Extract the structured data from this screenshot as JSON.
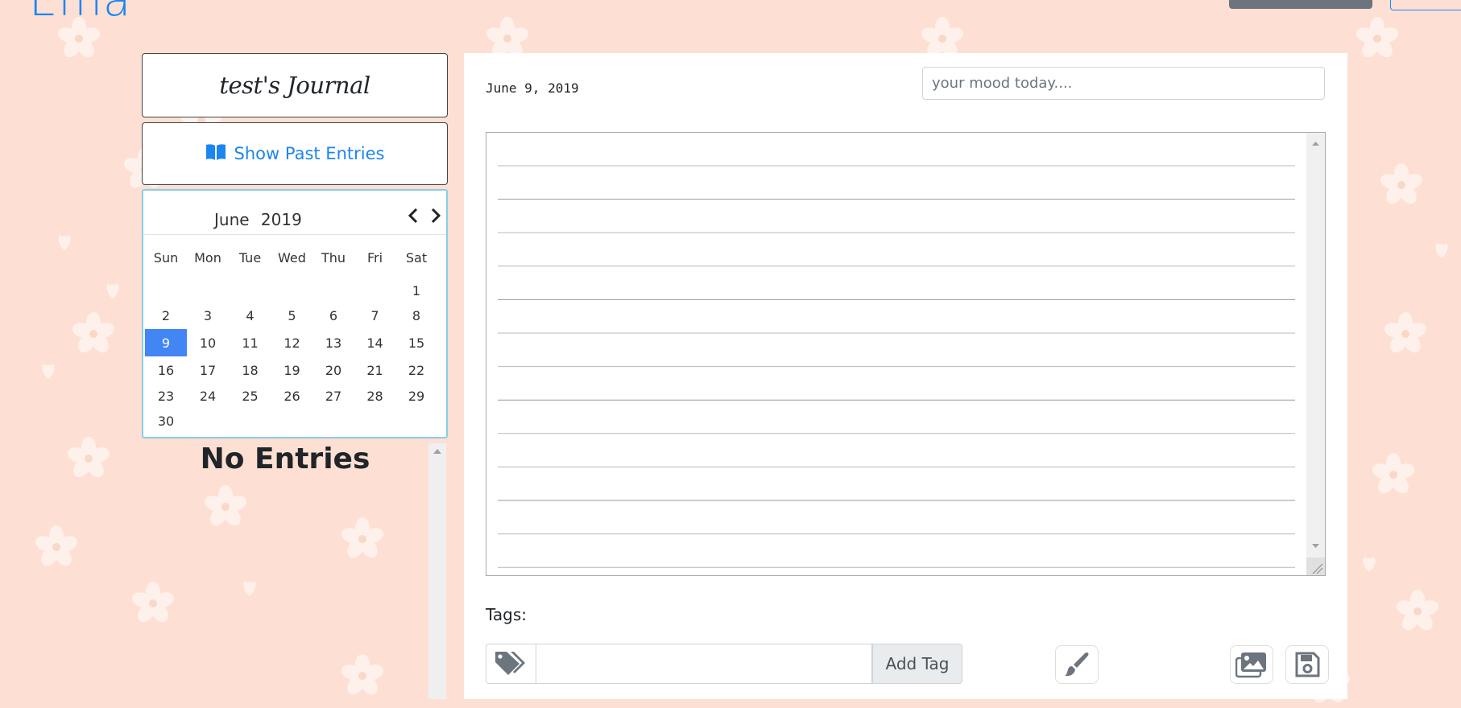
{
  "app": {
    "brand": "Ema",
    "colors": {
      "accent": "#1a86f2",
      "background": "#fde0d3",
      "selected_day": "#4285f4",
      "calendar_border": "#87ceeb"
    }
  },
  "sidebar": {
    "journal_title": "test's Journal",
    "past_entries_label": "Show Past Entries",
    "past_entries_icon": "book-open-icon",
    "no_entries_text": "No Entries"
  },
  "calendar": {
    "month": "June",
    "year": "2019",
    "weekdays": [
      "Sun",
      "Mon",
      "Tue",
      "Wed",
      "Thu",
      "Fri",
      "Sat"
    ],
    "weeks": [
      [
        "",
        "",
        "",
        "",
        "",
        "",
        "1"
      ],
      [
        "2",
        "3",
        "4",
        "5",
        "6",
        "7",
        "8"
      ],
      [
        "9",
        "10",
        "11",
        "12",
        "13",
        "14",
        "15"
      ],
      [
        "16",
        "17",
        "18",
        "19",
        "20",
        "21",
        "22"
      ],
      [
        "23",
        "24",
        "25",
        "26",
        "27",
        "28",
        "29"
      ],
      [
        "30",
        "",
        "",
        "",
        "",
        "",
        ""
      ]
    ],
    "selected_day": "9"
  },
  "entry": {
    "date": "June 9, 2019",
    "mood_placeholder": "your mood today....",
    "mood_value": "",
    "body_text": ""
  },
  "tags": {
    "label": "Tags:",
    "input_value": "",
    "add_label": "Add Tag"
  },
  "toolbar": {
    "paint_icon": "paintbrush-icon",
    "image_icon": "images-icon",
    "save_icon": "save-icon"
  }
}
